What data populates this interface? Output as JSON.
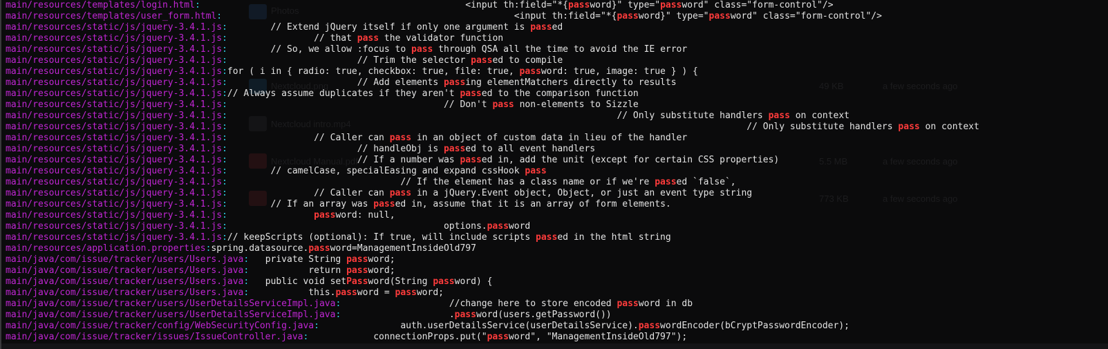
{
  "terminal": {
    "colors": {
      "background": "#0b0b0c",
      "filename": "#c026d3",
      "separator": "#2dd4e8",
      "match": "#ff3b3b",
      "text": "#e4e4e4"
    },
    "lines": [
      {
        "file": "main/resources/templates/login.html",
        "pad": "                                                 ",
        "parts": [
          "<input th:field=\"*{",
          "pass",
          "word}\" type=\"",
          "pass",
          "word\" class=\"form-control\"/>"
        ]
      },
      {
        "file": "main/resources/templates/user_form.html",
        "pad": "                                                      ",
        "parts": [
          "<input th:field=\"*{",
          "pass",
          "word}\" type=\"",
          "pass",
          "word\" class=\"form-control\"/>"
        ]
      },
      {
        "file": "main/resources/static/js/jquery-3.4.1.js",
        "pad": "        ",
        "parts": [
          "// Extend jQuery itself if only one argument is ",
          "pass",
          "ed"
        ]
      },
      {
        "file": "main/resources/static/js/jquery-3.4.1.js",
        "pad": "                ",
        "parts": [
          "// that ",
          "pass",
          " the validator function"
        ]
      },
      {
        "file": "main/resources/static/js/jquery-3.4.1.js",
        "pad": "        ",
        "parts": [
          "// So, we allow :focus to ",
          "pass",
          " through QSA all the time to avoid the IE error"
        ]
      },
      {
        "file": "main/resources/static/js/jquery-3.4.1.js",
        "pad": "                        ",
        "parts": [
          "// Trim the selector ",
          "pass",
          "ed to compile"
        ]
      },
      {
        "file": "main/resources/static/js/jquery-3.4.1.js",
        "pad": "",
        "parts": [
          "for ( i in { radio: true, checkbox: true, file: true, ",
          "pass",
          "word: true, image: true } ) {"
        ]
      },
      {
        "file": "main/resources/static/js/jquery-3.4.1.js",
        "pad": "                        ",
        "parts": [
          "// Add elements ",
          "pass",
          "ing elementMatchers directly to results"
        ]
      },
      {
        "file": "main/resources/static/js/jquery-3.4.1.js",
        "pad": "",
        "parts": [
          "// Always assume duplicates if they aren't ",
          "pass",
          "ed to the comparison function"
        ]
      },
      {
        "file": "main/resources/static/js/jquery-3.4.1.js",
        "pad": "                                        ",
        "parts": [
          "// Don't ",
          "pass",
          " non-elements to Sizzle"
        ]
      },
      {
        "file": "main/resources/static/js/jquery-3.4.1.js",
        "pad": "                                                                        ",
        "parts": [
          "// Only substitute handlers ",
          "pass",
          " on context"
        ]
      },
      {
        "file": "main/resources/static/js/jquery-3.4.1.js",
        "pad": "                                                                                                ",
        "parts": [
          "// Only substitute handlers ",
          "pass",
          " on context"
        ]
      },
      {
        "file": "main/resources/static/js/jquery-3.4.1.js",
        "pad": "                ",
        "parts": [
          "// Caller can ",
          "pass",
          " in an object of custom data in lieu of the handler"
        ]
      },
      {
        "file": "main/resources/static/js/jquery-3.4.1.js",
        "pad": "                        ",
        "parts": [
          "// handleObj is ",
          "pass",
          "ed to all event handlers"
        ]
      },
      {
        "file": "main/resources/static/js/jquery-3.4.1.js",
        "pad": "                        ",
        "parts": [
          "// If a number was ",
          "pass",
          "ed in, add the unit (except for certain CSS properties)"
        ]
      },
      {
        "file": "main/resources/static/js/jquery-3.4.1.js",
        "pad": "        ",
        "parts": [
          "// camelCase, specialEasing and expand cssHook ",
          "pass"
        ]
      },
      {
        "file": "main/resources/static/js/jquery-3.4.1.js",
        "pad": "                                ",
        "parts": [
          "// If the element has a class name or if we're ",
          "pass",
          "ed `false`,"
        ]
      },
      {
        "file": "main/resources/static/js/jquery-3.4.1.js",
        "pad": "                ",
        "parts": [
          "// Caller can ",
          "pass",
          " in a jQuery.Event object, Object, or just an event type string"
        ]
      },
      {
        "file": "main/resources/static/js/jquery-3.4.1.js",
        "pad": "        ",
        "parts": [
          "// If an array was ",
          "pass",
          "ed in, assume that it is an array of form elements."
        ]
      },
      {
        "file": "main/resources/static/js/jquery-3.4.1.js",
        "pad": "                ",
        "parts": [
          "",
          "pass",
          "word: null,"
        ]
      },
      {
        "file": "main/resources/static/js/jquery-3.4.1.js",
        "pad": "                                        ",
        "parts": [
          "options.",
          "pass",
          "word"
        ]
      },
      {
        "file": "main/resources/static/js/jquery-3.4.1.js",
        "pad": "",
        "parts": [
          "// keepScripts (optional): If true, will include scripts ",
          "pass",
          "ed in the html string"
        ]
      },
      {
        "file": "main/resources/application.properties",
        "pad": "",
        "parts": [
          "spring.datasource.",
          "pass",
          "word=ManagementInsideOld797"
        ]
      },
      {
        "file": "main/java/com/issue/tracker/users/Users.java",
        "pad": "   ",
        "parts": [
          "private String ",
          "pass",
          "word;"
        ]
      },
      {
        "file": "main/java/com/issue/tracker/users/Users.java",
        "pad": "           ",
        "parts": [
          "return ",
          "pass",
          "word;"
        ]
      },
      {
        "file": "main/java/com/issue/tracker/users/Users.java",
        "pad": "   ",
        "parts": [
          "public void set",
          "Pass",
          "word(String ",
          "pass",
          "word) {"
        ]
      },
      {
        "file": "main/java/com/issue/tracker/users/Users.java",
        "pad": "           ",
        "parts": [
          "this.",
          "pass",
          "word = ",
          "pass",
          "word;"
        ]
      },
      {
        "file": "main/java/com/issue/tracker/users/UserDetailsServiceImpl.java",
        "pad": "                    ",
        "parts": [
          "//change here to store encoded ",
          "pass",
          "word in db"
        ]
      },
      {
        "file": "main/java/com/issue/tracker/users/UserDetailsServiceImpl.java",
        "pad": "                    ",
        "parts": [
          ".",
          "pass",
          "word(users.getPassword())"
        ]
      },
      {
        "file": "main/java/com/issue/tracker/config/WebSecurityConfig.java",
        "pad": "               ",
        "parts": [
          "auth.userDetailsService(userDetailsService).",
          "pass",
          "wordEncoder(bCryptPasswordEncoder);"
        ]
      },
      {
        "file": "main/java/com/issue/tracker/issues/IssueController.java",
        "pad": "            ",
        "parts": [
          "connectionProps.put(\"",
          "pass",
          "word\", \"ManagementInsideOld797\");"
        ]
      }
    ]
  },
  "background_window": {
    "items": [
      {
        "name": "Photos",
        "icon": "folder-icon"
      },
      {
        "name": "Nextcloud.png",
        "icon": "image-icon",
        "size": "49 KB",
        "modified": "a few seconds ago"
      },
      {
        "name": "Nextcloud intro.mp4",
        "icon": "video-icon"
      },
      {
        "name": "Nextcloud Manual.pdf",
        "icon": "pdf-icon",
        "size": "5.5 MB",
        "modified": "a few seconds ago"
      },
      {
        "name": "",
        "icon": "pdf-icon",
        "size": "773 KB",
        "modified": "a few seconds ago"
      }
    ]
  }
}
